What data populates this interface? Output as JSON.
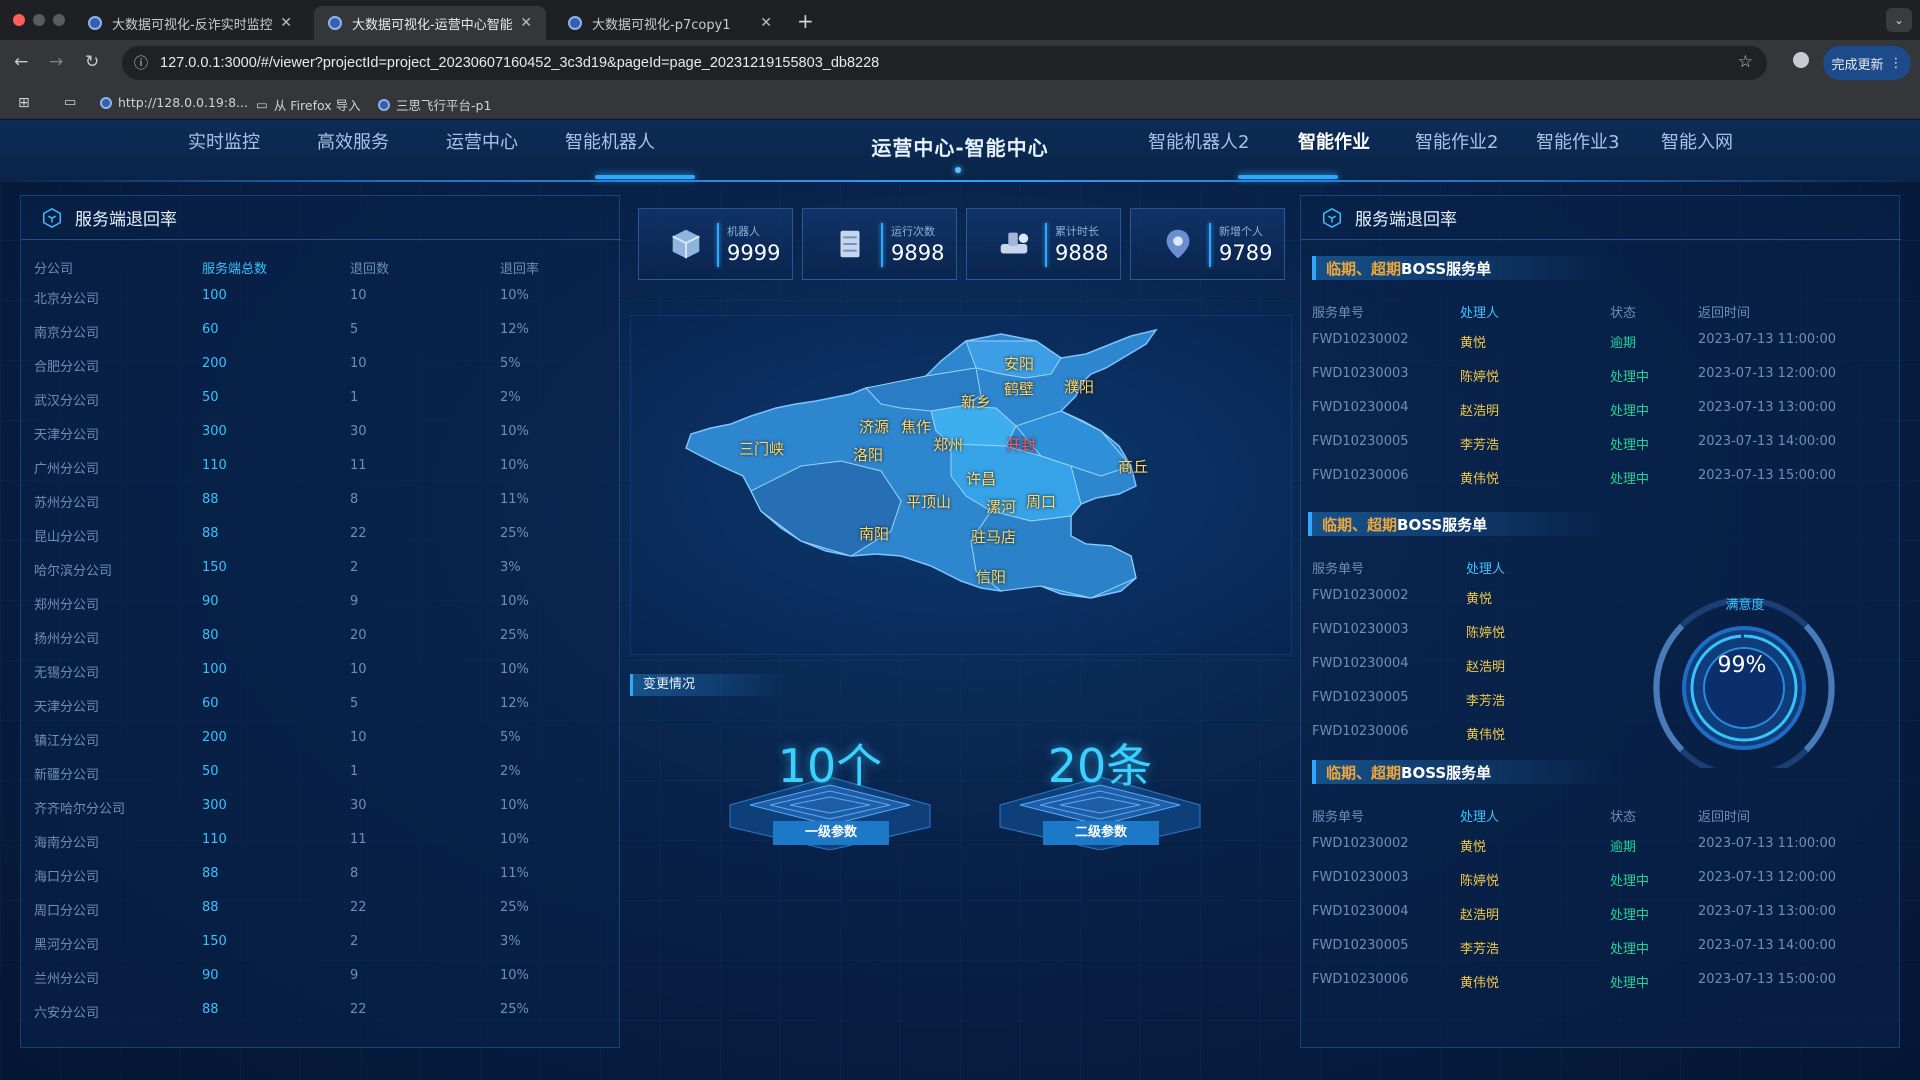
{
  "browser": {
    "tabs": [
      {
        "title": "大数据可视化-反诈实时监控"
      },
      {
        "title": "大数据可视化-运营中心智能作业"
      },
      {
        "title": "大数据可视化-p7copy1"
      }
    ],
    "url": "127.0.0.1:3000/#/viewer?projectId=project_20230607160452_3c3d19&pageId=page_20231219155803_db8228",
    "update_label": "完成更新",
    "bookmarks": [
      "http://128.0.0.19:8...",
      "从 Firefox 导入",
      "三思飞行平台-p1"
    ]
  },
  "nav": {
    "left": [
      "实时监控",
      "高效服务",
      "运营中心",
      "智能机器人"
    ],
    "title": "运营中心-智能中心",
    "right": [
      "智能机器人2",
      "智能作业",
      "智能作业2",
      "智能作业3",
      "智能入网"
    ],
    "active_right_index": 1
  },
  "left_panel": {
    "title": "服务端退回率",
    "headers": [
      "分公司",
      "服务端总数",
      "退回数",
      "退回率"
    ],
    "rows": [
      [
        "北京分公司",
        "100",
        "10",
        "10%"
      ],
      [
        "南京分公司",
        "60",
        "5",
        "12%"
      ],
      [
        "合肥分公司",
        "200",
        "10",
        "5%"
      ],
      [
        "武汉分公司",
        "50",
        "1",
        "2%"
      ],
      [
        "天津分公司",
        "300",
        "30",
        "10%"
      ],
      [
        "广州分公司",
        "110",
        "11",
        "10%"
      ],
      [
        "苏州分公司",
        "88",
        "8",
        "11%"
      ],
      [
        "昆山分公司",
        "88",
        "22",
        "25%"
      ],
      [
        "哈尔滨分公司",
        "150",
        "2",
        "3%"
      ],
      [
        "郑州分公司",
        "90",
        "9",
        "10%"
      ],
      [
        "扬州分公司",
        "80",
        "20",
        "25%"
      ],
      [
        "无锡分公司",
        "100",
        "10",
        "10%"
      ],
      [
        "天津分公司",
        "60",
        "5",
        "12%"
      ],
      [
        "镇江分公司",
        "200",
        "10",
        "5%"
      ],
      [
        "新疆分公司",
        "50",
        "1",
        "2%"
      ],
      [
        "齐齐哈尔分公司",
        "300",
        "30",
        "10%"
      ],
      [
        "海南分公司",
        "110",
        "11",
        "10%"
      ],
      [
        "海口分公司",
        "88",
        "8",
        "11%"
      ],
      [
        "周口分公司",
        "88",
        "22",
        "25%"
      ],
      [
        "黑河分公司",
        "150",
        "2",
        "3%"
      ],
      [
        "兰州分公司",
        "90",
        "9",
        "10%"
      ],
      [
        "六安分公司",
        "88",
        "22",
        "25%"
      ]
    ]
  },
  "stats": [
    {
      "label": "机器人",
      "value": "9999",
      "icon": "cube-icon"
    },
    {
      "label": "运行次数",
      "value": "9898",
      "icon": "server-icon"
    },
    {
      "label": "累计时长",
      "value": "9888",
      "icon": "pipe-icon"
    },
    {
      "label": "新增个人",
      "value": "9789",
      "icon": "location-pin-icon"
    }
  ],
  "map": {
    "cities": [
      "安阳",
      "鹤壁",
      "濮阳",
      "新乡",
      "济源",
      "焦作",
      "郑州",
      "开封",
      "三门峡",
      "洛阳",
      "商丘",
      "许昌",
      "平顶山",
      "漯河",
      "周口",
      "南阳",
      "驻马店",
      "信阳"
    ]
  },
  "changes": {
    "title": "变更情况",
    "items": [
      {
        "value": "10个",
        "label": "一级参数"
      },
      {
        "value": "20条",
        "label": "二级参数"
      }
    ]
  },
  "right_panel": {
    "title": "服务端退回率",
    "sections": [
      {
        "title_accent": "临期、超期",
        "title_rest": " BOSS服务单",
        "headers": [
          "服务单号",
          "处理人",
          "状态",
          "返回时间"
        ],
        "rows": [
          [
            "FWD10230002",
            "黄悦",
            "逾期",
            "2023-07-13 11:00:00"
          ],
          [
            "FWD10230003",
            "陈婷悦",
            "处理中",
            "2023-07-13 12:00:00"
          ],
          [
            "FWD10230004",
            "赵浩明",
            "处理中",
            "2023-07-13 13:00:00"
          ],
          [
            "FWD10230005",
            "李芳浩",
            "处理中",
            "2023-07-13 14:00:00"
          ],
          [
            "FWD10230006",
            "黄伟悦",
            "处理中",
            "2023-07-13 15:00:00"
          ]
        ]
      },
      {
        "title_accent": "临期、超期",
        "title_rest": " BOSS服务单",
        "headers": [
          "服务单号",
          "处理人"
        ],
        "rows": [
          [
            "FWD10230002",
            "黄悦"
          ],
          [
            "FWD10230003",
            "陈婷悦"
          ],
          [
            "FWD10230004",
            "赵浩明"
          ],
          [
            "FWD10230005",
            "李芳浩"
          ],
          [
            "FWD10230006",
            "黄伟悦"
          ]
        ]
      },
      {
        "title_accent": "临期、超期",
        "title_rest": " BOSS服务单",
        "headers": [
          "服务单号",
          "处理人",
          "状态",
          "返回时间"
        ],
        "rows": [
          [
            "FWD10230002",
            "黄悦",
            "逾期",
            "2023-07-13 11:00:00"
          ],
          [
            "FWD10230003",
            "陈婷悦",
            "处理中",
            "2023-07-13 12:00:00"
          ],
          [
            "FWD10230004",
            "赵浩明",
            "处理中",
            "2023-07-13 13:00:00"
          ],
          [
            "FWD10230005",
            "李芳浩",
            "处理中",
            "2023-07-13 14:00:00"
          ],
          [
            "FWD10230006",
            "黄伟悦",
            "处理中",
            "2023-07-13 15:00:00"
          ]
        ]
      }
    ],
    "gauge": {
      "title": "满意度",
      "value": "99%",
      "fraction": 0.99
    }
  },
  "colors": {
    "accent": "#2fa7ff",
    "value_blue": "#38c3ff",
    "highlight_orange": "#f0a73a",
    "city_label": "#ffd86a",
    "map_fill": "#2e86cf"
  }
}
